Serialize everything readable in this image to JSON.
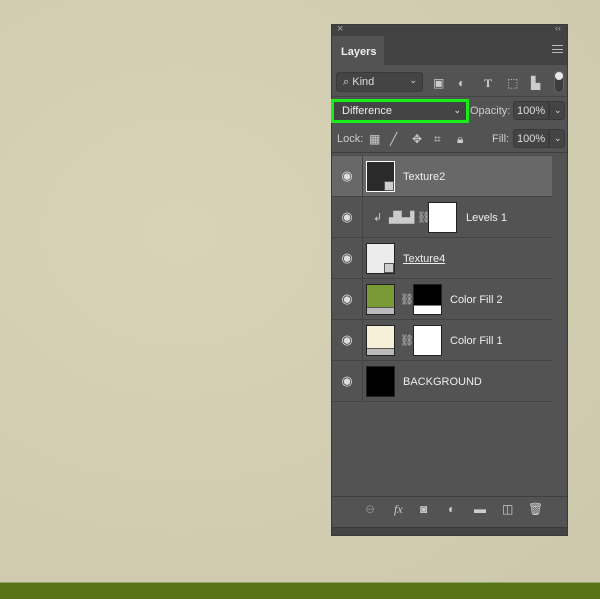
{
  "panel": {
    "title": "Layers",
    "close_icon": "×",
    "collapse_icon": "‹‹"
  },
  "filter": {
    "kind_label": "Kind",
    "kind_icon": "⌕"
  },
  "blend": {
    "mode": "Difference",
    "opacity_label": "Opacity:",
    "opacity": "100%",
    "fill_label": "Fill:",
    "fill": "100%",
    "lock_label": "Lock:"
  },
  "layers": [
    {
      "name": "Texture2",
      "visible": true,
      "selected": true
    },
    {
      "name": "Levels 1",
      "visible": true
    },
    {
      "name": "Texture4",
      "visible": true
    },
    {
      "name": "Color Fill 2",
      "visible": true
    },
    {
      "name": "Color Fill 1",
      "visible": true
    },
    {
      "name": "BACKGROUND",
      "visible": true
    }
  ],
  "colors": {
    "highlight": "#17ee17",
    "fill2": "#7a9a37",
    "fill1": "#f7f0d8",
    "ground": "#577417"
  },
  "icons": {
    "eye": "👁",
    "chev": "⌄",
    "link": "⛓"
  }
}
